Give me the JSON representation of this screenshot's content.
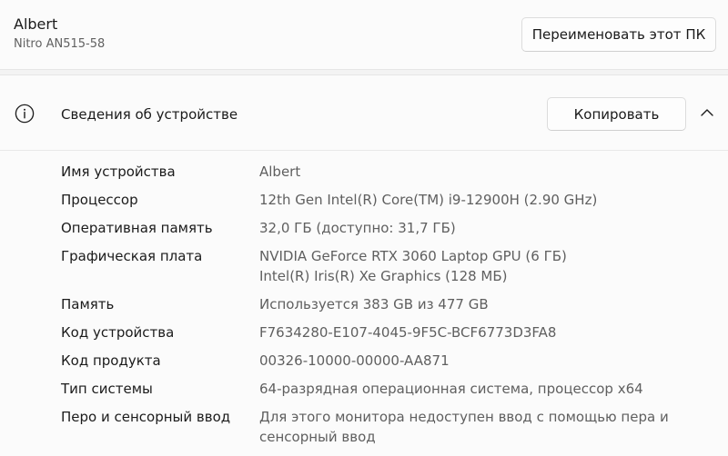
{
  "device": {
    "name": "Albert",
    "model": "Nitro AN515-58",
    "rename_label": "Переименовать этот ПК"
  },
  "info_section": {
    "icon": "info-icon",
    "title": "Сведения об устройстве",
    "copy_label": "Копировать",
    "collapse_icon": "chevron-up-icon"
  },
  "specs": [
    {
      "label": "Имя устройства",
      "values": [
        "Albert"
      ]
    },
    {
      "label": "Процессор",
      "values": [
        "12th Gen Intel(R) Core(TM) i9-12900H (2.90 GHz)"
      ]
    },
    {
      "label": "Оперативная память",
      "values": [
        "32,0 ГБ (доступно: 31,7 ГБ)"
      ]
    },
    {
      "label": "Графическая плата",
      "values": [
        "NVIDIA GeForce RTX 3060 Laptop GPU (6 ГБ)",
        "Intel(R) Iris(R) Xe Graphics (128 МБ)"
      ]
    },
    {
      "label": "Память",
      "values": [
        "Используется 383 GB из 477 GB"
      ]
    },
    {
      "label": "Код устройства",
      "values": [
        "F7634280-E107-4045-9F5C-BCF6773D3FA8"
      ]
    },
    {
      "label": "Код продукта",
      "values": [
        "00326-10000-00000-AA871"
      ]
    },
    {
      "label": "Тип системы",
      "values": [
        "64-разрядная операционная система, процессор x64"
      ]
    },
    {
      "label": "Перо и сенсорный ввод",
      "values": [
        "Для этого монитора недоступен ввод с помощью пера и",
        "сенсорный ввод"
      ]
    }
  ]
}
